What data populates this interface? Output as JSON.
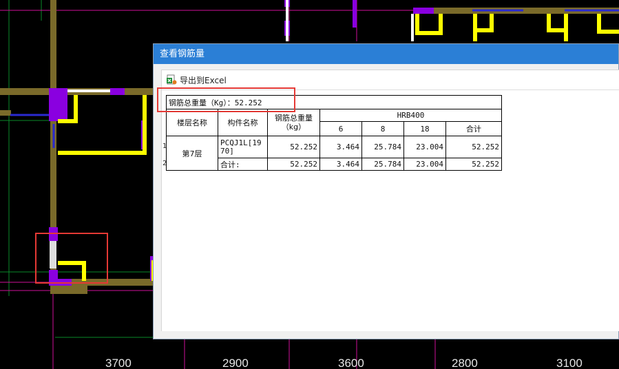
{
  "dialog": {
    "title": "查看钢筋量",
    "toolbar": {
      "export_label": "导出到Excel"
    },
    "summary": "钢筋总重量（Kg）：52.252",
    "table": {
      "headers": {
        "floor": "楼层名称",
        "component": "构件名称",
        "total_weight": "钢筋总重量（kg）",
        "grade": "HRB400",
        "diameters": [
          "6",
          "8",
          "18"
        ],
        "subtotal": "合计"
      },
      "row_indices": [
        "1",
        "2"
      ],
      "floor_name": "第7层",
      "rows": [
        {
          "component": "PCQJ1L[1970]",
          "total": "52.252",
          "d6": "3.464",
          "d8": "25.784",
          "d18": "23.004",
          "sum": "52.252"
        },
        {
          "component": "合计:",
          "total": "52.252",
          "d6": "3.464",
          "d8": "25.784",
          "d18": "23.004",
          "sum": "52.252"
        }
      ]
    }
  },
  "dimensions": [
    "3700",
    "2900",
    "3600",
    "2800",
    "3100"
  ],
  "colors": {
    "canvas_bg": "#000000",
    "wall": "#7a6a2a",
    "column": "#8a00e0",
    "rebar": "#ffff00",
    "axis_magenta": "#d0109a",
    "titlebar": "#2b7fd6",
    "highlight": "#e53935"
  }
}
